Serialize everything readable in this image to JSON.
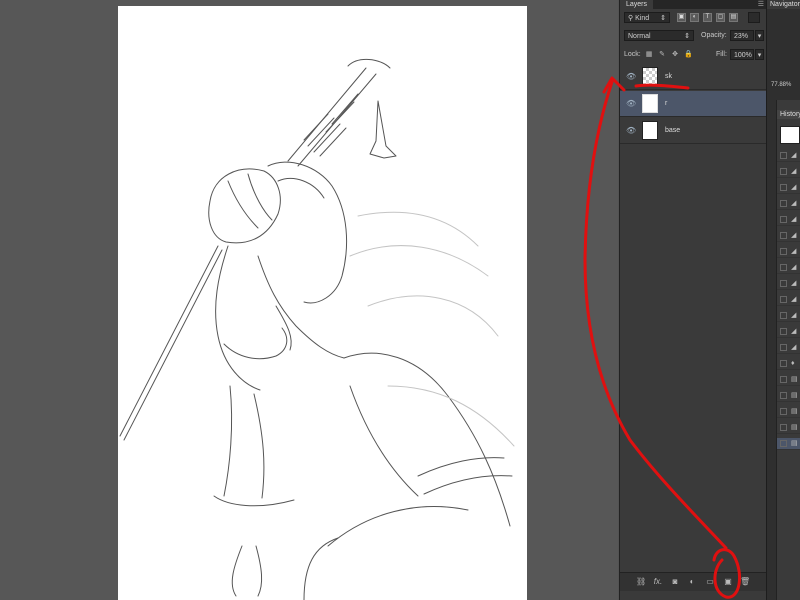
{
  "layers_panel": {
    "tab_label": "Layers",
    "filter_label": "Kind",
    "blend_mode": "Normal",
    "opacity_label": "Opacity:",
    "opacity_value": "23%",
    "lock_label": "Lock:",
    "fill_label": "Fill:",
    "fill_value": "100%",
    "layers": [
      {
        "name": "sk",
        "visible": true,
        "selected": false
      },
      {
        "name": "r",
        "visible": true,
        "selected": true
      },
      {
        "name": "base",
        "visible": true,
        "selected": false
      }
    ],
    "bottom_icons": [
      "link-icon",
      "fx-icon",
      "mask-icon",
      "adjustment-icon",
      "folder-icon",
      "new-layer-icon",
      "trash-icon"
    ],
    "fx_label": "fx."
  },
  "navigator": {
    "tab_label": "Navigator",
    "zoom": "77.88%"
  },
  "history": {
    "tab_label": "History"
  },
  "colors": {
    "annotation": "#e01010",
    "selected_layer": "#4c5669",
    "panel": "#3a3a3a"
  }
}
